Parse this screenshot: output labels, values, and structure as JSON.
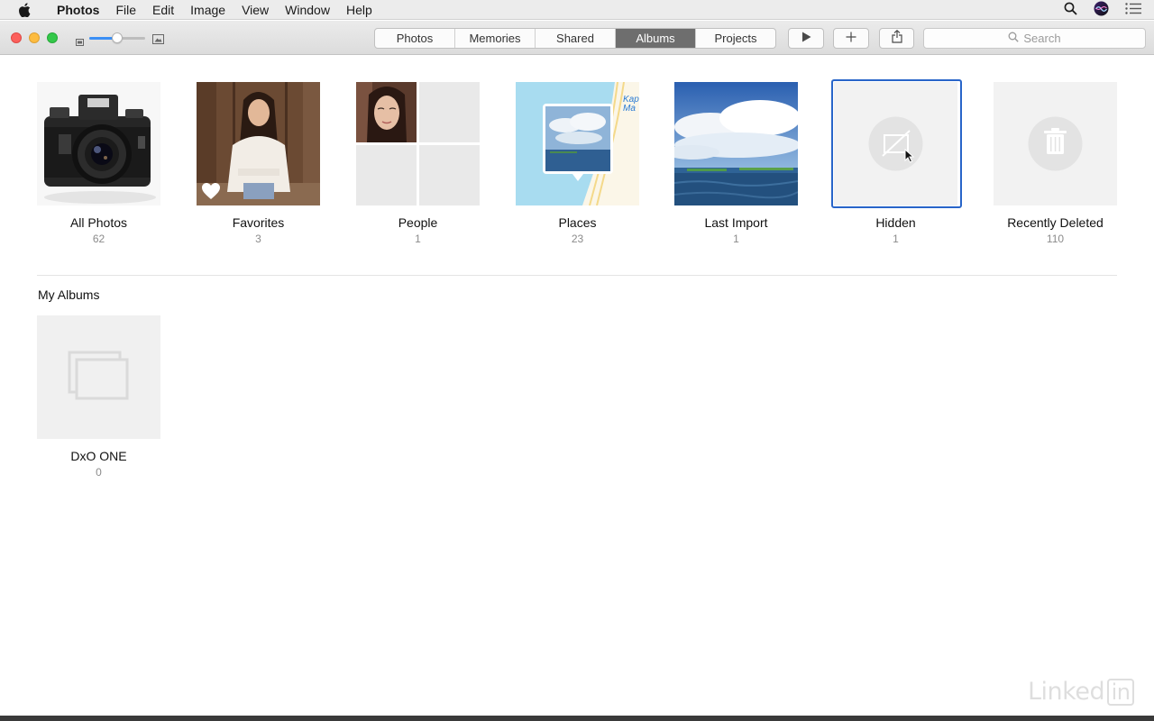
{
  "menubar": {
    "app_name": "Photos",
    "items": [
      "File",
      "Edit",
      "Image",
      "View",
      "Window",
      "Help"
    ]
  },
  "toolbar": {
    "thumbnail_zoom_level": 0.5,
    "tabs": [
      {
        "label": "Photos",
        "active": false
      },
      {
        "label": "Memories",
        "active": false
      },
      {
        "label": "Shared",
        "active": false
      },
      {
        "label": "Albums",
        "active": true
      },
      {
        "label": "Projects",
        "active": false
      }
    ],
    "buttons": [
      "play-slideshow-icon",
      "plus-icon",
      "share-icon"
    ],
    "search_placeholder": "Search"
  },
  "albums": [
    {
      "name": "All Photos",
      "count": "62",
      "thumb": "camera-photo"
    },
    {
      "name": "Favorites",
      "count": "3",
      "thumb": "portrait-photo"
    },
    {
      "name": "People",
      "count": "1",
      "thumb": "face-grid"
    },
    {
      "name": "Places",
      "count": "23",
      "thumb": "map",
      "map_label": "Kap Ma"
    },
    {
      "name": "Last Import",
      "count": "1",
      "thumb": "ocean-photo"
    },
    {
      "name": "Hidden",
      "count": "1",
      "thumb": "hidden-icon",
      "selected": true
    },
    {
      "name": "Recently Deleted",
      "count": "110",
      "thumb": "trash-icon"
    }
  ],
  "my_albums": {
    "title": "My Albums",
    "items": [
      {
        "name": "DxO ONE",
        "count": "0",
        "thumb": "empty-album-icon"
      }
    ]
  },
  "watermark": {
    "text": "Linked",
    "box": "in"
  },
  "colors": {
    "selection": "#2865c9",
    "active_tab": "#6e6e6e",
    "accent": "#3b8ff5"
  }
}
